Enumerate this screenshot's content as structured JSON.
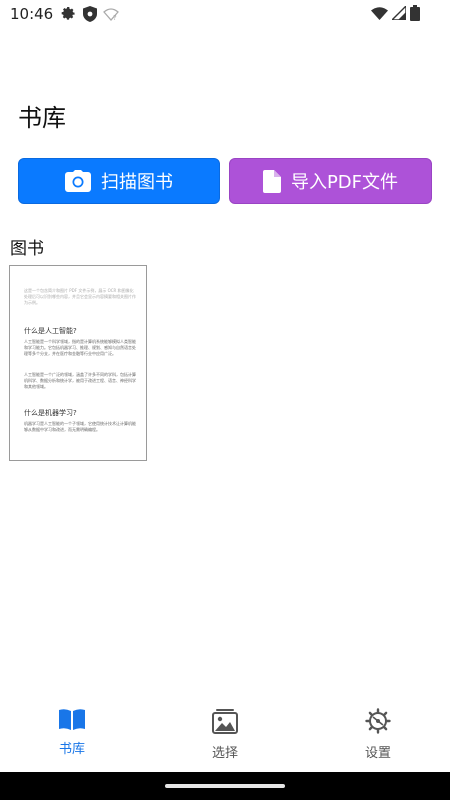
{
  "status_bar": {
    "time": "10:46",
    "icons": [
      "gear-icon",
      "shield-icon",
      "wifi-outline-icon",
      "wifi-icon",
      "cellular-icon",
      "battery-icon"
    ]
  },
  "page": {
    "title": "书库"
  },
  "actions": {
    "scan": {
      "label": "扫描图书",
      "icon": "camera-icon",
      "color": "#0a7aff"
    },
    "import": {
      "label": "导入PDF文件",
      "icon": "document-icon",
      "color": "#ad52d8"
    }
  },
  "books_section": {
    "label": "图书"
  },
  "book": {
    "intro": "这是一个包含简介和图片 PDF 文件示例，展示 OCR 和图像化处理后可以识别哪些内容，并且它会显示内容摘要和相关图片作为示例。",
    "heading1": "什么是人工智能?",
    "para1": "人工智能是一个科学领域，指的是计算机系统能够模拟人类智能和学习能力。它包括机器学习、推理、规划、感知与自然语言处理等多个分支，并在医疗和金融等行业中应用广泛。",
    "para2": "人工智能是一个广泛的领域，涵盖了许多不同的学科，包括计算机科学、数据分析和统计学，被用于改进工程、语言、神经科学和其他领域。",
    "heading2": "什么是机器学习?",
    "para3": "机器学习是人工智能的一个子领域，它使用统计技术让计算机能够从数据中学习和改进，而无需明确编程。"
  },
  "bottom_nav": {
    "active": "library",
    "active_color": "#1976e8",
    "items": [
      {
        "id": "library",
        "label": "书库",
        "icon": "open-book-icon"
      },
      {
        "id": "select",
        "label": "选择",
        "icon": "image-gallery-icon"
      },
      {
        "id": "settings",
        "label": "设置",
        "icon": "settings-wheel-icon"
      }
    ]
  }
}
